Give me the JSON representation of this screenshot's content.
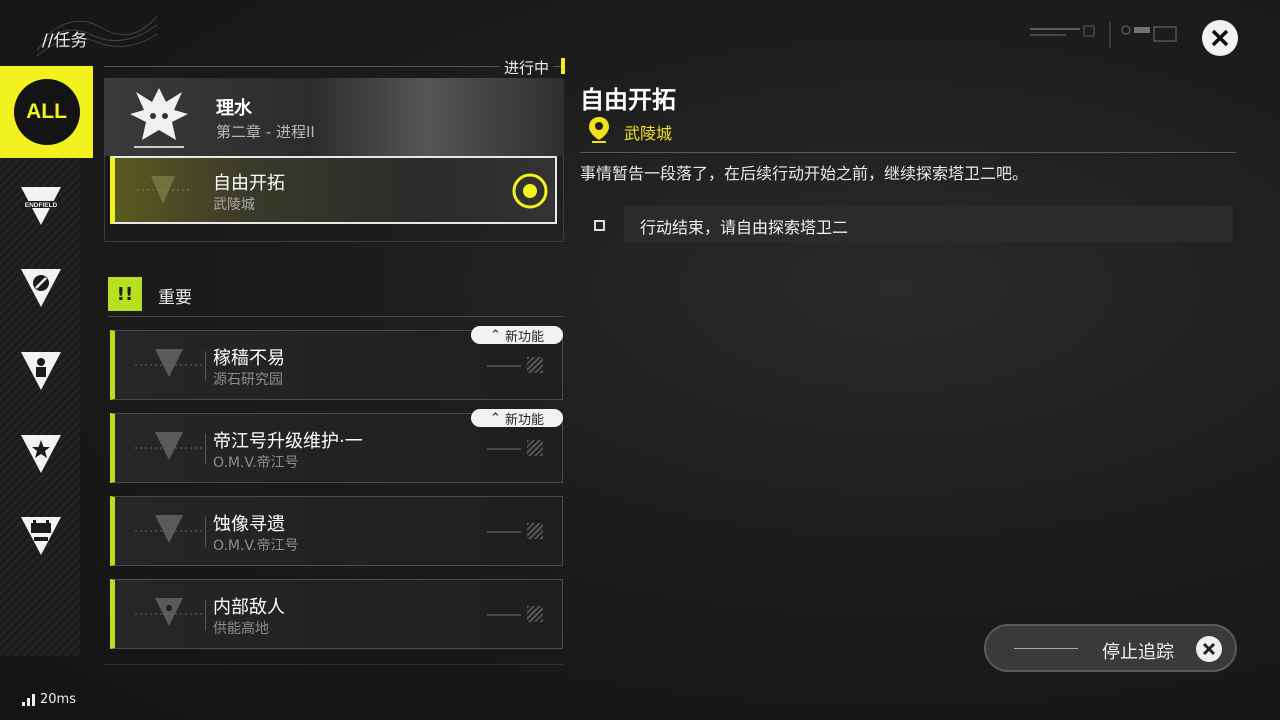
{
  "header": {
    "breadcrumb": "//任务"
  },
  "sidebar": {
    "all_label": "ALL",
    "items": [
      {
        "icon": "endfield-icon",
        "label": "ENDFIELD"
      },
      {
        "icon": "compass-icon"
      },
      {
        "icon": "person-icon"
      },
      {
        "icon": "star-icon"
      },
      {
        "icon": "battery-icon"
      }
    ]
  },
  "in_progress": {
    "label": "进行中",
    "main_quest": {
      "title": "理水",
      "subtitle": "第二章 - 进程II"
    },
    "active_quest": {
      "title": "自由开拓",
      "location": "武陵城"
    }
  },
  "important": {
    "badge": "!!",
    "title": "重要",
    "quests": [
      {
        "title": "稼穑不易",
        "location": "源石研究园",
        "tag": "新功能"
      },
      {
        "title": "帝江号升级维护·一",
        "location": "O.M.V.帝江号",
        "tag": "新功能"
      },
      {
        "title": "蚀像寻遗",
        "location": "O.M.V.帝江号",
        "tag": ""
      },
      {
        "title": "内部敌人",
        "location": "供能高地",
        "tag": ""
      }
    ]
  },
  "detail": {
    "title": "自由开拓",
    "location": "武陵城",
    "description": "事情暂告一段落了，在后续行动开始之前，继续探索塔卫二吧。",
    "objective": "行动结束，请自由探索塔卫二"
  },
  "stop_tracking": {
    "label": "停止追踪"
  },
  "status": {
    "ping": "20ms"
  },
  "colors": {
    "accent": "#f2f21e",
    "important": "#b6e021"
  }
}
